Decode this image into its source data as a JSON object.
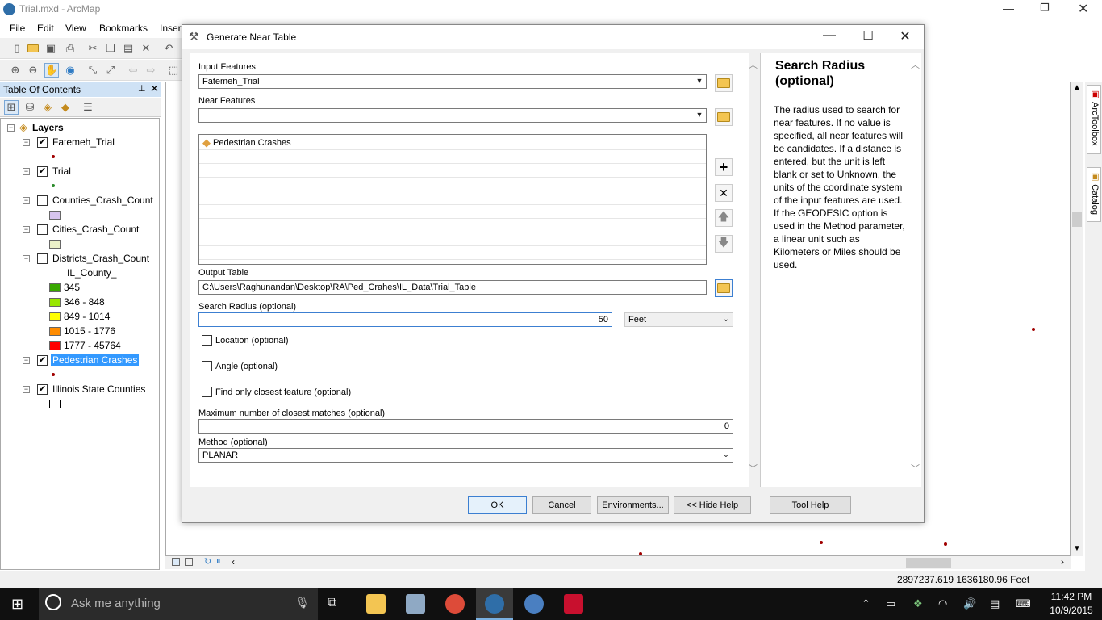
{
  "app": {
    "title": "Trial.mxd - ArcMap"
  },
  "menu": [
    "File",
    "Edit",
    "View",
    "Bookmarks",
    "Inser"
  ],
  "toc": {
    "title": "Table Of Contents",
    "root": "Layers",
    "layers": [
      {
        "name": "Fatemeh_Trial",
        "checked": true
      },
      {
        "name": "Trial",
        "checked": true
      },
      {
        "name": "Counties_Crash_Count",
        "checked": false
      },
      {
        "name": "Cities_Crash_Count",
        "checked": false
      },
      {
        "name": "Districts_Crash_Count",
        "checked": false,
        "field": "IL_County_",
        "classes": [
          {
            "label": "345",
            "color": "#38a800"
          },
          {
            "label": "346 - 848",
            "color": "#98e600"
          },
          {
            "label": "849 - 1014",
            "color": "#ffff00"
          },
          {
            "label": "1015 - 1776",
            "color": "#ff8c00"
          },
          {
            "label": "1777 - 45764",
            "color": "#ff0000"
          }
        ]
      },
      {
        "name": "Pedestrian Crashes",
        "checked": true,
        "selected": true
      },
      {
        "name": "Illinois State Counties",
        "checked": true
      }
    ]
  },
  "dock": {
    "arctoolbox": "ArcToolbox",
    "catalog": "Catalog"
  },
  "status": {
    "coords": "2897237.619  1636180.96 Feet"
  },
  "dialog": {
    "title": "Generate Near Table",
    "input_features_label": "Input Features",
    "input_features_value": "Fatemeh_Trial",
    "near_features_label": "Near Features",
    "near_features_value": "",
    "near_list": [
      "Pedestrian Crashes"
    ],
    "output_table_label": "Output Table",
    "output_table_value": "C:\\Users\\Raghunandan\\Desktop\\RA\\Ped_Crahes\\IL_Data\\Trial_Table",
    "search_radius_label": "Search Radius (optional)",
    "search_radius_value": "50",
    "search_radius_unit": "Feet",
    "location_label": "Location (optional)",
    "angle_label": "Angle (optional)",
    "closest_label": "Find only closest feature (optional)",
    "max_matches_label": "Maximum number of closest matches (optional)",
    "max_matches_value": "0",
    "method_label": "Method (optional)",
    "method_value": "PLANAR",
    "buttons": {
      "ok": "OK",
      "cancel": "Cancel",
      "environments": "Environments...",
      "hide_help": "<< Hide Help",
      "tool_help": "Tool Help"
    },
    "help": {
      "title": "Search Radius (optional)",
      "text": "The radius used to search for near features. If no value is specified, all near features will be candidates. If a distance is entered, but the unit is left blank or set to Unknown, the units of the coordinate system of the input features are used. If the GEODESIC option is used in the Method parameter, a linear unit such as Kilometers or Miles should be used."
    }
  },
  "taskbar": {
    "search_placeholder": "Ask me anything",
    "time": "11:42 PM",
    "date": "10/9/2015"
  }
}
